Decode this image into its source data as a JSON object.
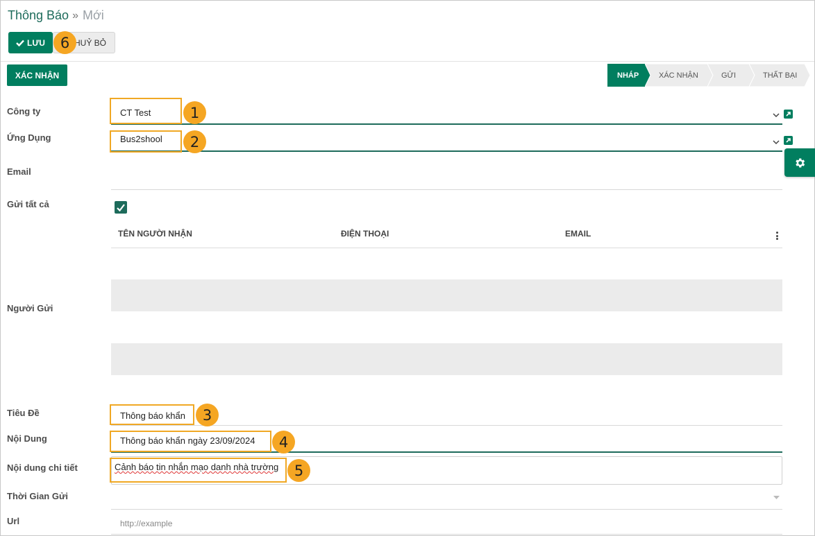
{
  "breadcrumb": {
    "parent": "Thông Báo",
    "separator": "»",
    "current": "Mới"
  },
  "toolbar": {
    "save_label": "LƯU",
    "cancel_label": "HUỶ BỎ"
  },
  "confirm_button": "XÁC NHẬN",
  "status_stages": [
    {
      "label": "NHÁP",
      "active": true
    },
    {
      "label": "XÁC NHẬN",
      "active": false
    },
    {
      "label": "GỬI",
      "active": false
    },
    {
      "label": "THẤT BẠI",
      "active": false
    }
  ],
  "fields": {
    "company": {
      "label": "Công ty",
      "value": "CT Test"
    },
    "app": {
      "label": "Ứng Dụng",
      "value": "Bus2shool"
    },
    "email": {
      "label": "Email",
      "value": ""
    },
    "send_all": {
      "label": "Gửi tất cả",
      "checked": true
    },
    "sender": {
      "label": "Người Gửi"
    },
    "title": {
      "label": "Tiêu Đề",
      "value": "Thông báo khẩn"
    },
    "content": {
      "label": "Nội Dung",
      "value": "Thông báo khẩn ngày 23/09/2024"
    },
    "detail": {
      "label": "Nội dung chi tiết",
      "value": "Cảnh báo tin nhắn mạo danh nhà trường"
    },
    "send_time": {
      "label": "Thời Gian Gửi",
      "value": ""
    },
    "url": {
      "label": "Url",
      "placeholder": "http://example"
    }
  },
  "recipients_table": {
    "columns": [
      "TÊN NGƯỜI NHẬN",
      "ĐIỆN THOẠI",
      "EMAIL"
    ]
  },
  "annotations": [
    "1",
    "2",
    "3",
    "4",
    "5",
    "6"
  ],
  "colors": {
    "primary": "#017e5f",
    "annotation": "#f5a623"
  },
  "icons": [
    "check-icon",
    "external-link-icon",
    "chevron-down-icon",
    "gear-icon",
    "kebab-menu-icon"
  ]
}
